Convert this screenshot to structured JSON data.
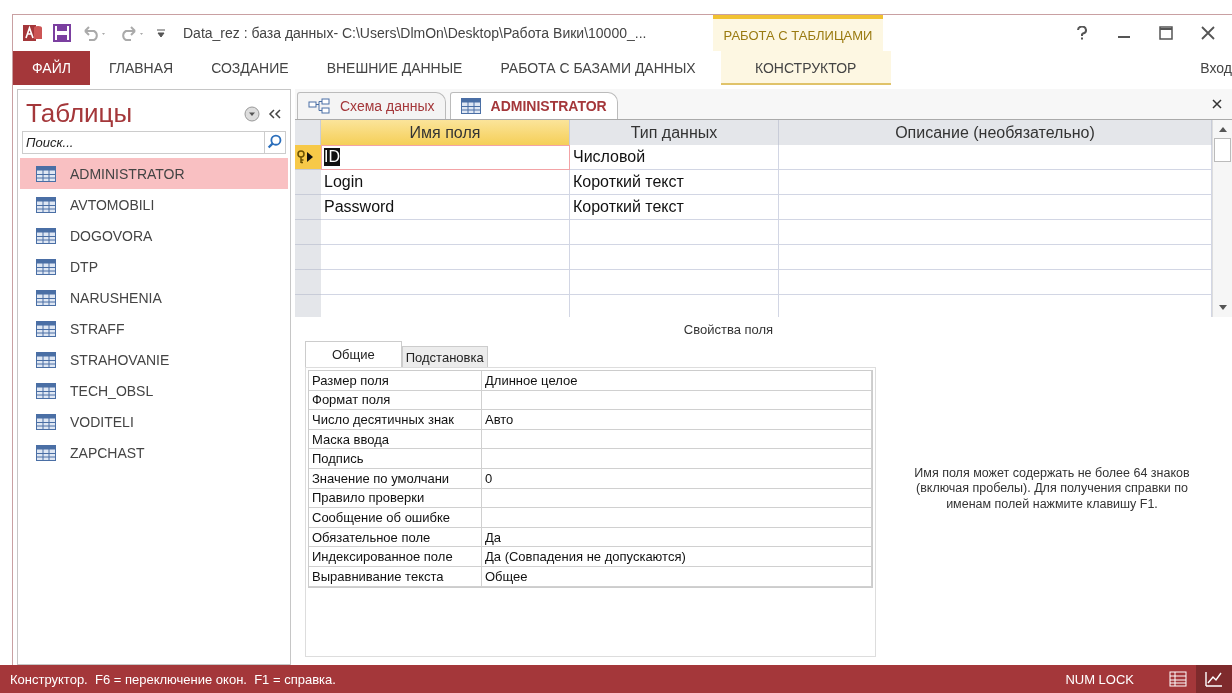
{
  "window": {
    "title": "Data_rez : база данных- C:\\Users\\DlmOn\\Desktop\\Работа Вики\\10000_...",
    "context_group": "РАБОТА С ТАБЛИЦАМИ",
    "sign_in": "Вход"
  },
  "ribbon_tabs": [
    {
      "label": "ФАЙЛ",
      "kind": "file",
      "selected": false
    },
    {
      "label": "ГЛАВНАЯ",
      "kind": "normal",
      "selected": false
    },
    {
      "label": "СОЗДАНИЕ",
      "kind": "normal",
      "selected": false
    },
    {
      "label": "ВНЕШНИЕ ДАННЫЕ",
      "kind": "normal",
      "selected": false
    },
    {
      "label": "РАБОТА С БАЗАМИ ДАННЫХ",
      "kind": "normal",
      "selected": false
    },
    {
      "label": "КОНСТРУКТОР",
      "kind": "context",
      "selected": true
    }
  ],
  "navigation_pane": {
    "title": "Таблицы",
    "search": {
      "placeholder": "Поиск..."
    },
    "items": [
      {
        "label": "ADMINISTRATOR",
        "selected": true
      },
      {
        "label": "AVTOMOBILI",
        "selected": false
      },
      {
        "label": "DOGOVORA",
        "selected": false
      },
      {
        "label": "DTP",
        "selected": false
      },
      {
        "label": "NARUSHENIA",
        "selected": false
      },
      {
        "label": "STRAFF",
        "selected": false
      },
      {
        "label": "STRAHOVANIE",
        "selected": false
      },
      {
        "label": "TECH_OBSL",
        "selected": false
      },
      {
        "label": "VODITELI",
        "selected": false
      },
      {
        "label": "ZAPCHAST",
        "selected": false
      }
    ]
  },
  "document_tabs": [
    {
      "label": "Схема данных",
      "kind": "diagram",
      "selected": false
    },
    {
      "label": "ADMINISTRATOR",
      "kind": "table",
      "selected": true
    }
  ],
  "design_grid": {
    "columns": [
      {
        "label": "Имя поля",
        "selected": true
      },
      {
        "label": "Тип данных",
        "selected": false
      },
      {
        "label": "Описание (необязательно)",
        "selected": false
      }
    ],
    "rows": [
      {
        "name": "ID",
        "type": "Числовой",
        "primary_key": true,
        "current": true
      },
      {
        "name": "Login",
        "type": "Короткий текст",
        "primary_key": false,
        "current": false
      },
      {
        "name": "Password",
        "type": "Короткий текст",
        "primary_key": false,
        "current": false
      }
    ]
  },
  "field_properties": {
    "caption": "Свойства поля",
    "tabs": [
      {
        "label": "Общие",
        "selected": true
      },
      {
        "label": "Подстановка",
        "selected": false
      }
    ],
    "rows": [
      {
        "label": "Размер поля",
        "value": "Длинное целое"
      },
      {
        "label": "Формат поля"
      },
      {
        "label": "Число десятичных знак",
        "value": "Авто"
      },
      {
        "label": "Маска ввода"
      },
      {
        "label": "Подпись"
      },
      {
        "label": "Значение по умолчани",
        "value": "0"
      },
      {
        "label": "Правило проверки"
      },
      {
        "label": "Сообщение об ошибке"
      },
      {
        "label": "Обязательное поле",
        "value": "Да"
      },
      {
        "label": "Индексированное поле",
        "value": "Да (Совпадения не допускаются)"
      },
      {
        "label": "Выравнивание текста",
        "value": "Общее"
      }
    ],
    "help": "Имя поля может содержать не более 64 знаков (включая пробелы). Для получения справки по именам полей нажмите клавишу F1."
  },
  "status_bar": {
    "text": "Конструктор.  F6 = переключение окон.  F1 = справка.",
    "indicator": "NUM LOCK",
    "views": [
      {
        "kind": "datasheet",
        "selected": false
      },
      {
        "kind": "design",
        "selected": true
      }
    ]
  }
}
